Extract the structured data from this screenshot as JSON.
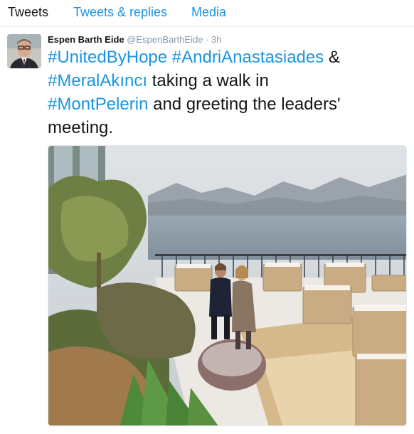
{
  "tabs": {
    "tweets": "Tweets",
    "tweets_replies": "Tweets & replies",
    "media": "Media"
  },
  "tweet": {
    "display_name": "Espen Barth Eide",
    "handle": "@EspenBarthEide",
    "separator": "·",
    "time": "3h",
    "text": {
      "hashtag1": "#UnitedByHope",
      "hashtag2": "#AndriAnastasiades",
      "amp": "&",
      "hashtag3": "#MeralAkıncı",
      "mid": "taking a walk in",
      "hashtag4": "#MontPelerin",
      "end": "and greeting the leaders' meeting."
    }
  },
  "colors": {
    "link": "#1b95e0",
    "text": "#14171a",
    "muted": "#8899a6",
    "border": "#e6ecf0"
  }
}
